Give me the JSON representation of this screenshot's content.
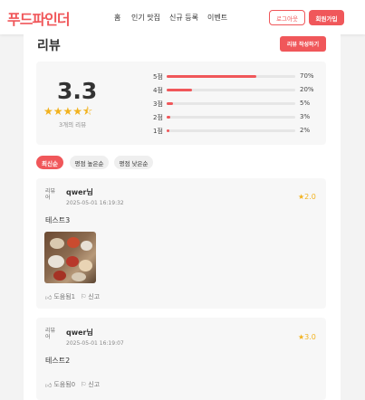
{
  "header": {
    "logo": "푸드파인더",
    "nav": [
      "홈",
      "인기 맛집",
      "신규 등록",
      "이벤트"
    ],
    "logout_label": "로그아웃",
    "signup_label": "회원가입"
  },
  "reviews_section": {
    "title": "리뷰",
    "write_label": "리뷰 작성하기",
    "average": "3.3",
    "stars": "★★★★⯪",
    "count_text": "3개의 리뷰",
    "distribution": [
      {
        "label": "5점",
        "percent": 70,
        "percent_text": "70%"
      },
      {
        "label": "4점",
        "percent": 20,
        "percent_text": "20%"
      },
      {
        "label": "3점",
        "percent": 5,
        "percent_text": "5%"
      },
      {
        "label": "2점",
        "percent": 3,
        "percent_text": "3%"
      },
      {
        "label": "1점",
        "percent": 2,
        "percent_text": "2%"
      }
    ],
    "sort_options": [
      "최신순",
      "평점 높은순",
      "평점 낮은순"
    ],
    "selected_sort": "최신순"
  },
  "reviews": [
    {
      "avatar_alt": "리뷰어",
      "user": "qwer님",
      "date": "2025-05-01 16:19:32",
      "rating": "2.0",
      "text": "테스트3",
      "helpful": "도움됨1",
      "report": "신고"
    },
    {
      "avatar_alt": "리뷰어",
      "user": "qwer님",
      "date": "2025-05-01 16:19:07",
      "rating": "3.0",
      "text": "테스트2",
      "helpful": "도움됨0",
      "report": "신고"
    }
  ],
  "colors": {
    "accent": "#f0575a",
    "star": "#f2b21e"
  }
}
